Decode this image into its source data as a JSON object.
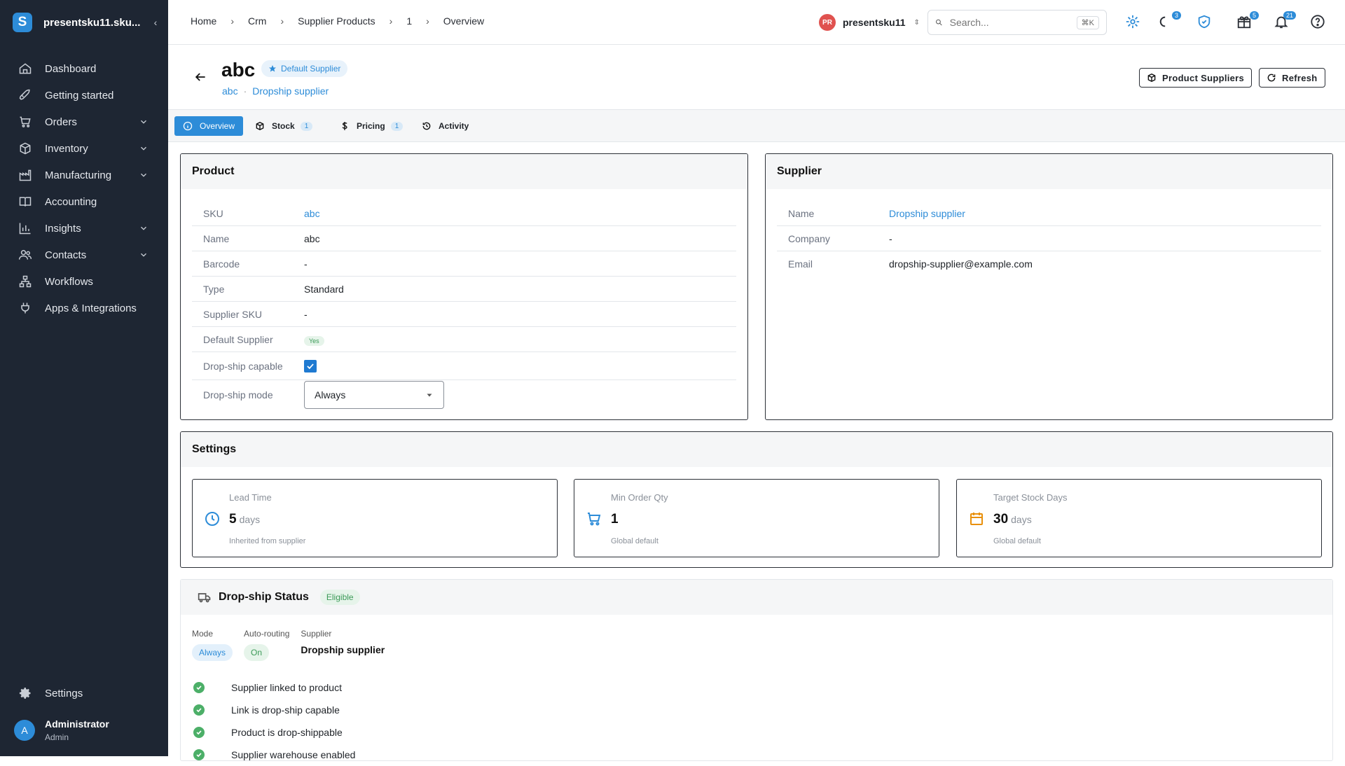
{
  "sidebar": {
    "org": "presentsku11.sku...",
    "logo_letter": "S",
    "items": [
      {
        "label": "Dashboard",
        "icon": "home-icon",
        "expandable": false
      },
      {
        "label": "Getting started",
        "icon": "rocket-icon",
        "expandable": false
      },
      {
        "label": "Orders",
        "icon": "cart-icon",
        "expandable": true
      },
      {
        "label": "Inventory",
        "icon": "box-icon",
        "expandable": true
      },
      {
        "label": "Manufacturing",
        "icon": "factory-icon",
        "expandable": true
      },
      {
        "label": "Accounting",
        "icon": "book-icon",
        "expandable": false
      },
      {
        "label": "Insights",
        "icon": "chart-icon",
        "expandable": true
      },
      {
        "label": "Contacts",
        "icon": "people-icon",
        "expandable": true
      },
      {
        "label": "Workflows",
        "icon": "workflow-icon",
        "expandable": false
      },
      {
        "label": "Apps & Integrations",
        "icon": "plug-icon",
        "expandable": false
      }
    ],
    "settings": "Settings",
    "user": {
      "initial": "A",
      "name": "Administrator",
      "role": "Admin"
    }
  },
  "topbar": {
    "breadcrumbs": [
      "Home",
      "Crm",
      "Supplier Products",
      "1",
      "Overview"
    ],
    "user_initials": "PR",
    "user_name": "presentsku11",
    "search_placeholder": "Search...",
    "search_shortcut": "⌘K",
    "badges": {
      "loading": "3",
      "gifts": "5",
      "notifications": "21"
    }
  },
  "header": {
    "title": "abc",
    "default_badge": "Default Supplier",
    "sub_product": "abc",
    "sub_supplier": "Dropship supplier",
    "btn_product_suppliers": "Product Suppliers",
    "btn_refresh": "Refresh"
  },
  "tabs": [
    {
      "label": "Overview",
      "count": ""
    },
    {
      "label": "Stock",
      "count": "1"
    },
    {
      "label": "Pricing",
      "count": "1"
    },
    {
      "label": "Activity",
      "count": ""
    }
  ],
  "product": {
    "title": "Product",
    "rows": [
      {
        "k": "SKU",
        "v": "abc"
      },
      {
        "k": "Name",
        "v": "abc"
      },
      {
        "k": "Barcode",
        "v": "-"
      },
      {
        "k": "Type",
        "v": "Standard"
      },
      {
        "k": "Supplier SKU",
        "v": "-"
      },
      {
        "k": "Default Supplier",
        "v": "Yes"
      },
      {
        "k": "Drop-ship capable",
        "v": ""
      },
      {
        "k": "Drop-ship mode",
        "v": "Always"
      }
    ]
  },
  "supplier": {
    "title": "Supplier",
    "rows": [
      {
        "k": "Name",
        "v": "Dropship supplier"
      },
      {
        "k": "Company",
        "v": "-"
      },
      {
        "k": "Email",
        "v": "dropship-supplier@example.com"
      }
    ]
  },
  "settings": {
    "title": "Settings",
    "stats": [
      {
        "label": "Lead Time",
        "value": "5",
        "unit": "days",
        "sub": "Inherited from supplier"
      },
      {
        "label": "Min Order Qty",
        "value": "1",
        "unit": "",
        "sub": "Global default"
      },
      {
        "label": "Target Stock Days",
        "value": "30",
        "unit": "days",
        "sub": "Global default"
      }
    ]
  },
  "dropship": {
    "title": "Drop-ship Status",
    "status": "Eligible",
    "mode_label": "Mode",
    "mode": "Always",
    "routing_label": "Auto-routing",
    "routing": "On",
    "supplier_label": "Supplier",
    "supplier": "Dropship supplier",
    "checks": [
      "Supplier linked to product",
      "Link is drop-ship capable",
      "Product is drop-shippable",
      "Supplier warehouse enabled"
    ]
  },
  "colors": {
    "accent": "#2d8cd8",
    "sidebar": "#1e2633",
    "success": "#4caf68",
    "stat_warn": "#e8900c"
  }
}
